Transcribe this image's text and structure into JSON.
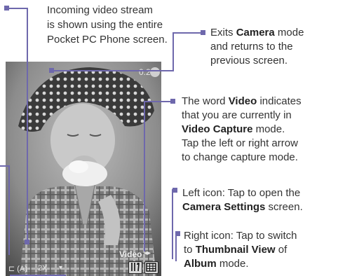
{
  "annotations": {
    "stream": {
      "line1": "Incoming video stream",
      "line2": "is shown using the entire",
      "line3": "Pocket PC Phone screen."
    },
    "exits": {
      "line1_pre": "Exits ",
      "line1_bold": "Camera",
      "line1_post": " mode",
      "line2": "and returns to the",
      "line3": "previous screen."
    },
    "video_word": {
      "line1_pre": "The word ",
      "line1_bold": "Video",
      "line1_post": " indicates",
      "line2": "that you are currently in",
      "line3_bold": "Video Capture",
      "line3_post": " mode.",
      "line4": "Tap the left or right arrow",
      "line5": "to change capture mode."
    },
    "left_icon": {
      "line1": "Left icon: Tap to open the",
      "line2_bold": "Camera Settings",
      "line2_post": " screen."
    },
    "right_icon": {
      "line1": "Right icon: Tap to switch",
      "line2_pre": "to ",
      "line2_bold": "Thumbnail View",
      "line2_post": " of",
      "line3_bold": "Album",
      "line3_post": " mode."
    }
  },
  "screen_overlay": {
    "time": "0:20",
    "mode_label": "Video",
    "zoom": "2X"
  },
  "icons": {
    "close": "close-icon",
    "settings": "camera-settings-icon",
    "album": "album-thumbnail-icon",
    "arrows": "mode-arrows-icon"
  },
  "colors": {
    "callout": "#6e68ac"
  }
}
